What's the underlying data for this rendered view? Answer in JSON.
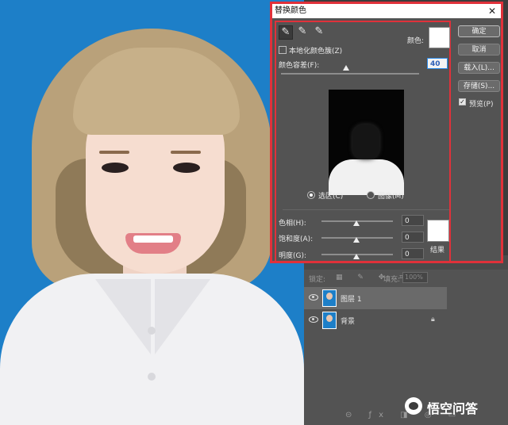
{
  "dialog": {
    "title": "替换颜色",
    "close_glyph": "✕",
    "localized_label": "本地化颜色簇(Z)",
    "color_label": "颜色:",
    "tolerance_label": "颜色容差(F):",
    "tolerance_value": "40",
    "selection_label": "选区(C)",
    "image_label": "图像(M)",
    "hue_label": "色相(H):",
    "hue_value": "0",
    "saturation_label": "饱和度(A):",
    "saturation_value": "0",
    "lightness_label": "明度(G):",
    "lightness_value": "0",
    "result_label": "结果",
    "ok_button": "确定",
    "cancel_button": "取消",
    "load_button": "载入(L)...",
    "save_button": "存储(S)...",
    "preview_label": "预览(P)",
    "preview_checked": true,
    "selection_checked": true,
    "color_swatch": "#ffffff",
    "result_swatch": "#ffffff"
  },
  "layers": {
    "lock_label": "锁定:",
    "fill_label": "填充:",
    "fill_value": "100%",
    "items": [
      {
        "name": "图层 1",
        "active": true
      },
      {
        "name": "背景",
        "active": false
      }
    ]
  },
  "watermark": {
    "text": "悟空问答"
  },
  "colors": {
    "accent": "#e0313a",
    "photo_bg": "#1d7fc8",
    "panel_bg": "#535353"
  }
}
